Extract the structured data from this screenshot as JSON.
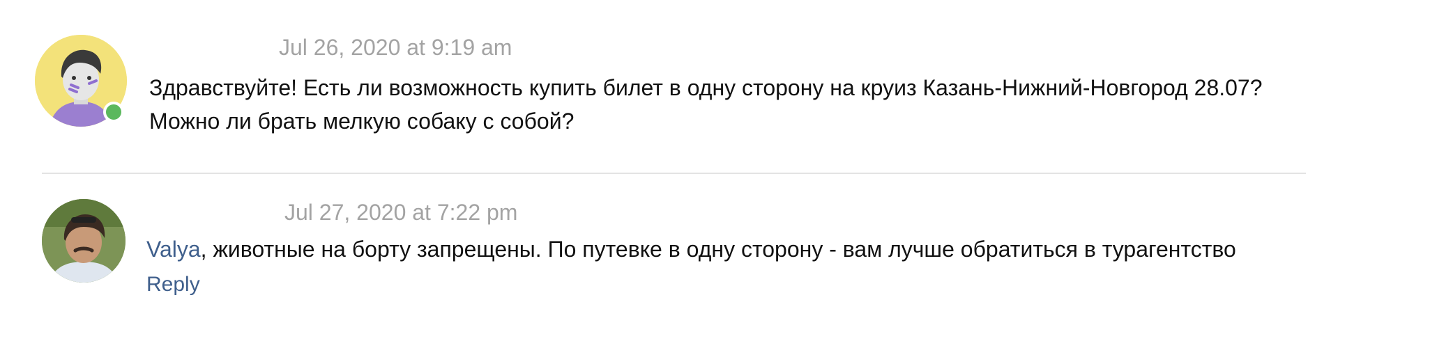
{
  "comments": [
    {
      "timestamp": "Jul 26, 2020 at 9:19 am",
      "text_lines": [
        "Здравствуйте! Есть ли возможность купить билет в одну сторону на круиз Казань-Нижний-Новгород 28.07?",
        "Можно ли брать мелкую собаку с собой?"
      ],
      "avatar_icon": "user-avatar-illustrated",
      "avatar_bg": "#f3e27a",
      "status_color": "#5bb85d"
    },
    {
      "timestamp": "Jul 27, 2020 at 7:22 pm",
      "mention": "Valya",
      "text": ", животные на борту запрещены. По путевке в одну сторону - вам лучше обратиться в турагентство",
      "reply_label": "Reply",
      "avatar_icon": "user-avatar-photo",
      "link_color": "#3f5f8c"
    }
  ]
}
